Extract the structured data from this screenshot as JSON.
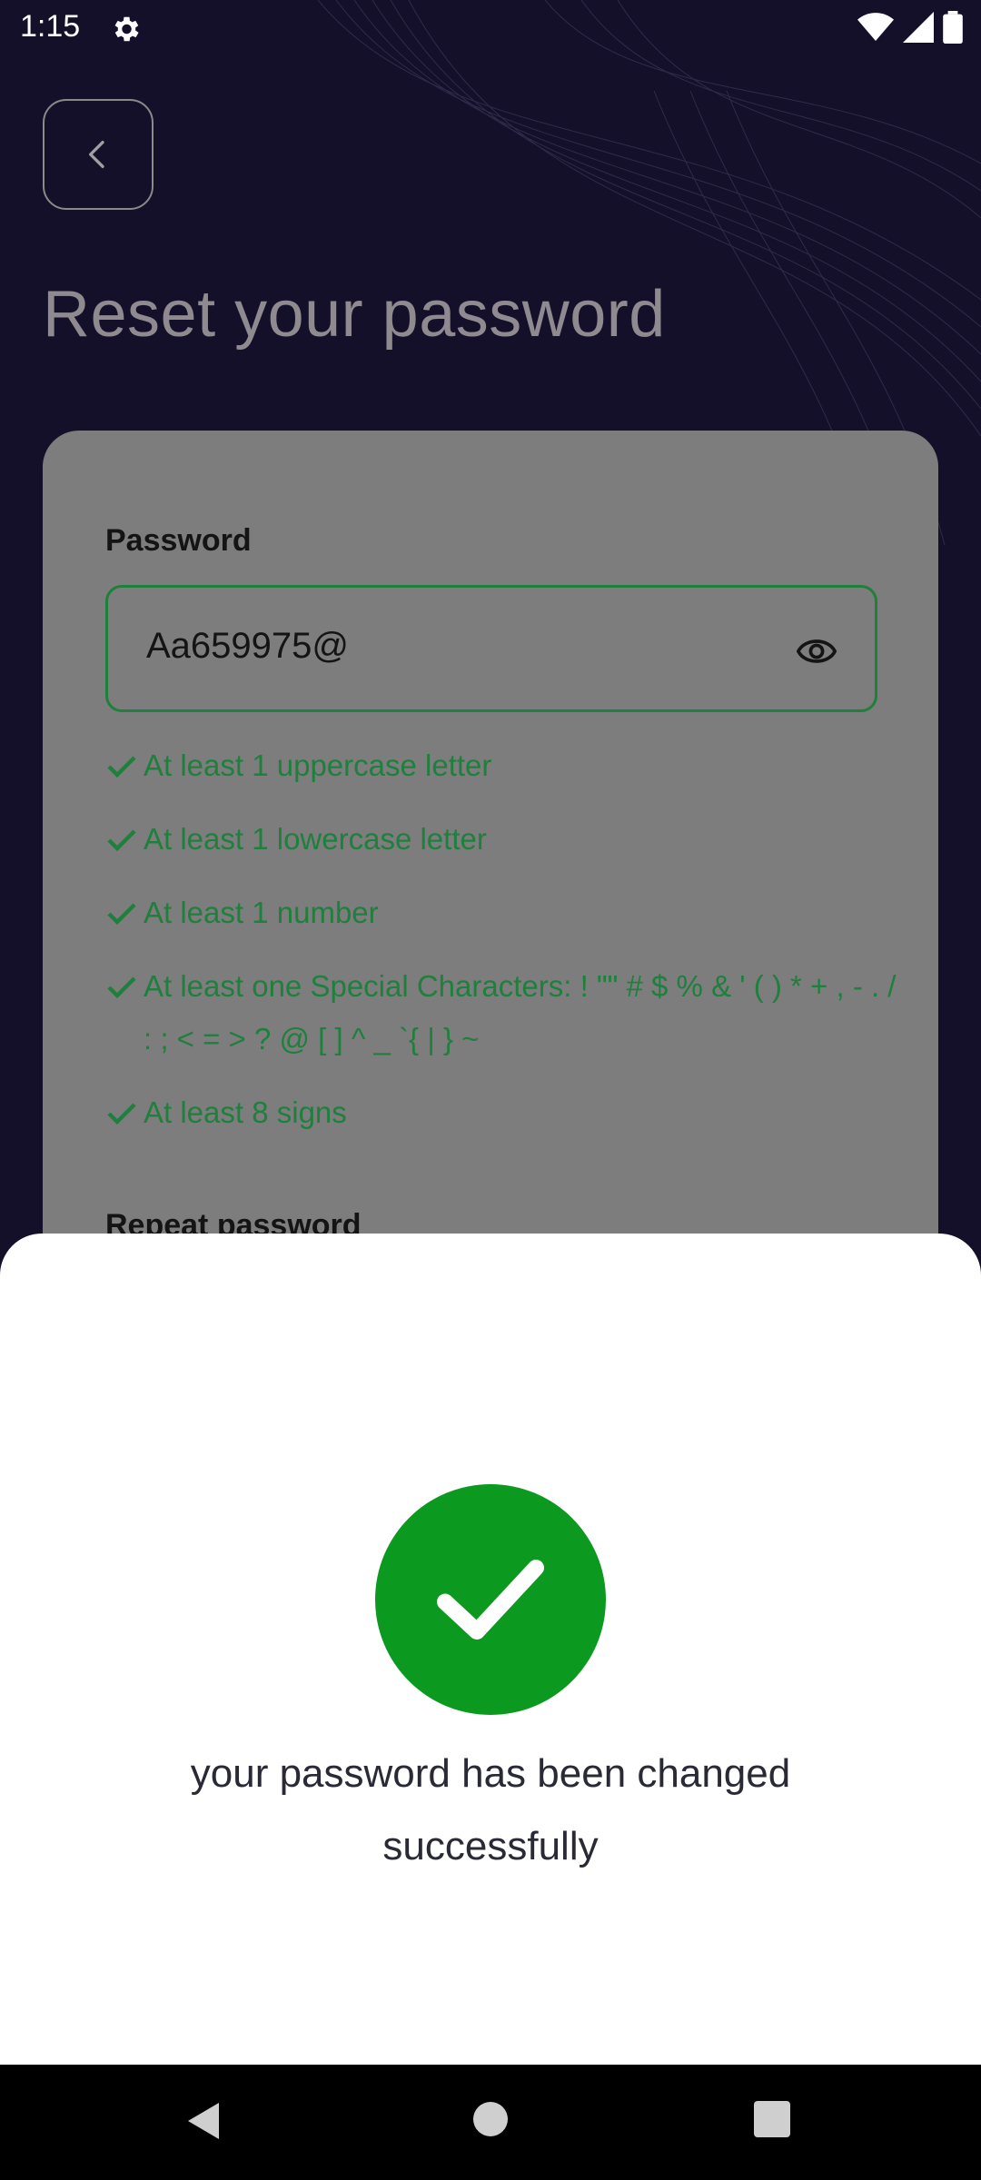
{
  "status_bar": {
    "time": "1:15",
    "icons": [
      "gear-icon",
      "wifi-icon",
      "signal-icon",
      "battery-icon"
    ]
  },
  "header": {
    "back_icon": "chevron-left-icon",
    "title": "Reset your password"
  },
  "form": {
    "password_label": "Password",
    "password_value": "Aa659975@",
    "visibility_icon": "eye-icon",
    "rules": [
      {
        "text": "At least 1 uppercase letter",
        "met": true
      },
      {
        "text": "At least 1 lowercase letter",
        "met": true
      },
      {
        "text": "At least 1 number",
        "met": true
      },
      {
        "text": "At least one Special Characters: ! \"\" # $ % & ' ( ) * + , - . / : ; < = > ? @ [  ] ^ _ `{ | } ~",
        "met": true
      },
      {
        "text": "At least 8 signs",
        "met": true
      }
    ],
    "repeat_label": "Repeat password"
  },
  "success_sheet": {
    "icon": "check-circle-icon",
    "message": "your password has been changed successfully"
  },
  "colors": {
    "background": "#14102a",
    "card": "#7d7d7d",
    "rule_green": "#1f7f3c",
    "success_green": "#0b991f"
  },
  "nav_bar": {
    "icons": [
      "nav-back-icon",
      "nav-home-icon",
      "nav-recents-icon"
    ]
  }
}
